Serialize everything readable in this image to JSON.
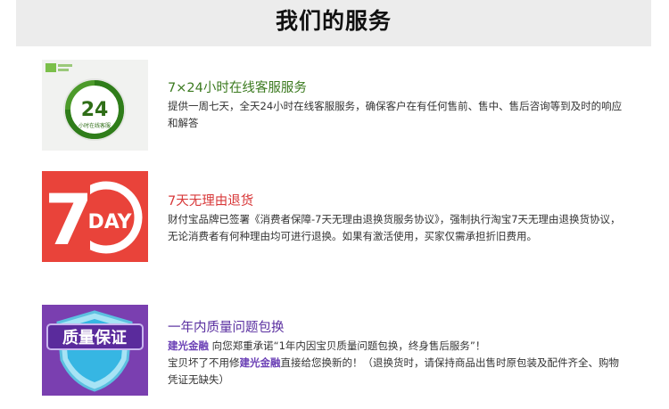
{
  "header": {
    "title": "我们的服务"
  },
  "services": [
    {
      "title": "7×24小时在线客服服务",
      "desc": "提供一周七天，全天24小时在线客服服务，确保客户在有任何售前、售中、售后咨询等到及时的响应和解答",
      "badge_number": "24",
      "badge_caption": "小时在线客服"
    },
    {
      "title": "7天无理由退货",
      "desc": "财付宝品牌已签署《消费者保障-7天无理由退换货服务协议》，强制执行淘宝7天无理由退换货协议，无论消费者有何种理由均可进行退换。如果有激活使用，买家仅需承担折旧费用。",
      "badge_number": "7",
      "badge_word": "DAY"
    },
    {
      "title": "一年内质量问题包换",
      "brand": "建光金融",
      "line1": " 向您郑重承诺“1年内因宝贝质量问题包换，终身售后服务”！",
      "line2a": "宝贝坏了不用修",
      "line2b": "直接给您换新的！（退换货时，请保持商品出售时原包装及配件齐全、购物凭证无缺失）",
      "badge_text": "质量保证"
    }
  ],
  "colors": {
    "green": "#3b7a1f",
    "red": "#d8393a",
    "purple": "#6a3fb5"
  }
}
